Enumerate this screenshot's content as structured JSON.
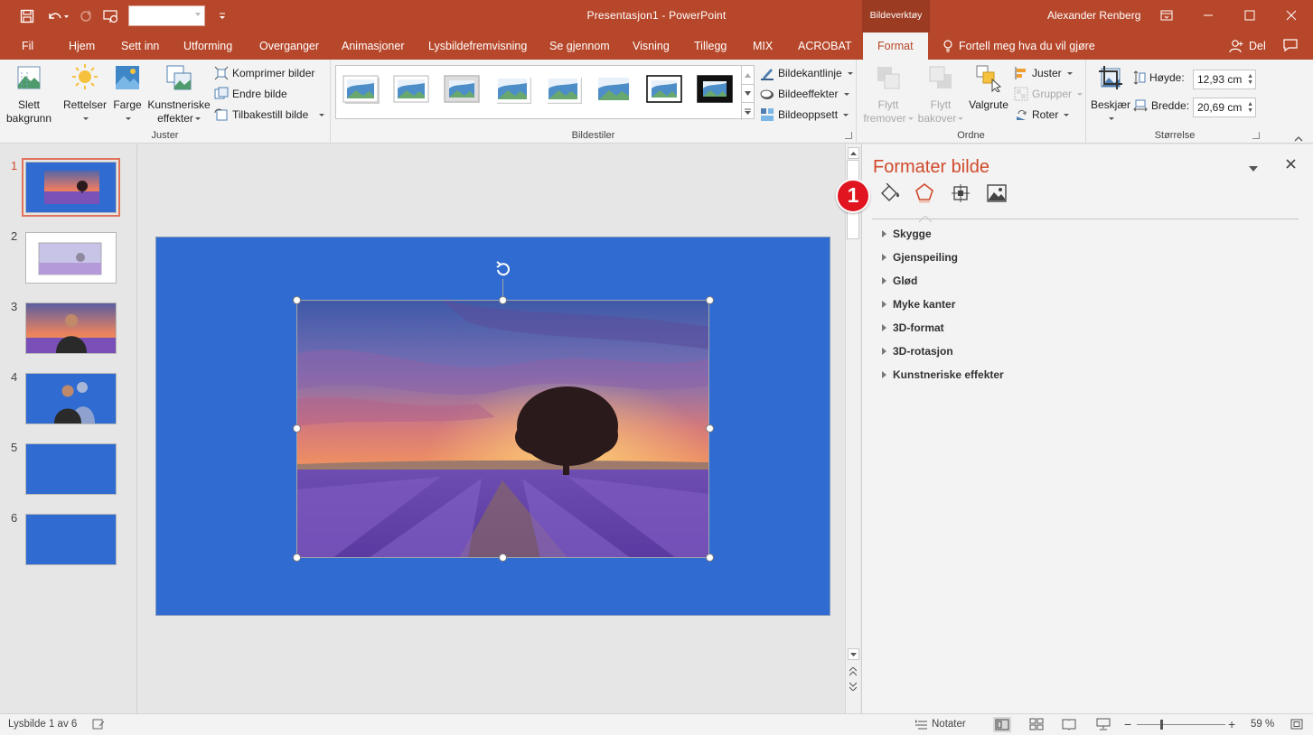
{
  "app": {
    "doc_title": "Presentasjon1  -  PowerPoint",
    "context_tab": "Bildeverktøy",
    "user": "Alexander Renberg"
  },
  "tabs": [
    "Fil",
    "Hjem",
    "Sett inn",
    "Utforming",
    "Overganger",
    "Animasjoner",
    "Lysbildefremvisning",
    "Se gjennom",
    "Visning",
    "Tillegg",
    "MIX",
    "ACROBAT",
    "Format"
  ],
  "active_tab": "Format",
  "tell_me": "Fortell meg hva du vil gjøre",
  "share": "Del",
  "ribbon": {
    "remove_bg_line1": "Slett",
    "remove_bg_line2": "bakgrunn",
    "corrections": "Rettelser",
    "color": "Farge",
    "artistic_line1": "Kunstneriske",
    "artistic_line2": "effekter",
    "compress": "Komprimer bilder",
    "change": "Endre bilde",
    "reset": "Tilbakestill bilde",
    "group_adjust": "Juster",
    "group_styles": "Bildestiler",
    "border": "Bildekantlinje",
    "effects": "Bildeeffekter",
    "layout": "Bildeoppsett",
    "forward_line1": "Flytt",
    "forward_line2": "fremover",
    "backward_line1": "Flytt",
    "backward_line2": "bakover",
    "selection_pane": "Valgrute",
    "align": "Juster",
    "group": "Grupper",
    "rotate": "Roter",
    "group_arrange": "Ordne",
    "crop": "Beskjær",
    "height_label": "Høyde:",
    "height_value": "12,93 cm",
    "width_label": "Bredde:",
    "width_value": "20,69 cm",
    "group_size": "Størrelse"
  },
  "slides": [
    {
      "num": "1",
      "selected": true
    },
    {
      "num": "2"
    },
    {
      "num": "3"
    },
    {
      "num": "4"
    },
    {
      "num": "5"
    },
    {
      "num": "6"
    }
  ],
  "pane": {
    "title": "Formater bilde",
    "callout": "1",
    "sections": [
      "Skygge",
      "Gjenspeiling",
      "Glød",
      "Myke kanter",
      "3D-format",
      "3D-rotasjon",
      "Kunstneriske effekter"
    ]
  },
  "status": {
    "slide_info": "Lysbilde 1 av 6",
    "notes": "Notater",
    "zoom": "59 %",
    "zoom_level": 0.59
  },
  "colors": {
    "accent": "#b7472a",
    "slide_bg": "#2f6bd1",
    "callout": "#e0151f"
  }
}
